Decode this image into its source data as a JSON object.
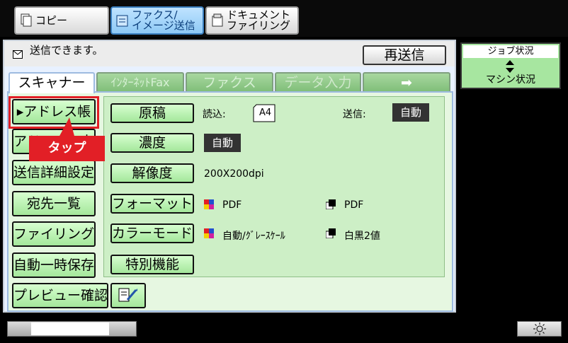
{
  "modes": [
    {
      "label": "コピー",
      "icon": "copy-icon"
    },
    {
      "label": "ファクス/\nイメージ送信",
      "icon": "fax-icon"
    },
    {
      "label": "ドキュメント\nファイリング",
      "icon": "filing-icon"
    }
  ],
  "status": {
    "message": "送信できます。",
    "resend_label": "再送信"
  },
  "tabs": [
    "スキャナー",
    "ｲﾝﾀｰﾈｯﾄFax",
    "ファクス",
    "データ入力",
    "➡"
  ],
  "side_buttons": [
    "▸アドレス帳",
    "アドレス入力",
    "送信詳細設定",
    "宛先一覧",
    "ファイリング",
    "自動一時保存",
    "プレビュー確認"
  ],
  "settings": {
    "original": {
      "label": "原稿",
      "read_label": "読込:",
      "read_value": "A4",
      "send_label": "送信:",
      "send_value": "自動"
    },
    "density": {
      "label": "濃度",
      "value": "自動"
    },
    "resolution": {
      "label": "解像度",
      "value": "200X200dpi"
    },
    "format": {
      "label": "フォーマット",
      "color_value": "PDF",
      "bw_value": "PDF"
    },
    "color_mode": {
      "label": "カラーモード",
      "color_value": "自動/ｸﾞﾚｰｽｹｰﾙ",
      "bw_value": "白黒2値"
    },
    "special": {
      "label": "特別機能"
    }
  },
  "annotation": {
    "tap_label": "タップ",
    "color": "#e21f26"
  },
  "job_status": {
    "title": "ジョブ状況",
    "subtitle": "マシン状況"
  },
  "colors": {
    "green_button": "#a4e79b",
    "panel_bg": "#e6f7e1",
    "accent_blue": "#3a7fc0"
  }
}
